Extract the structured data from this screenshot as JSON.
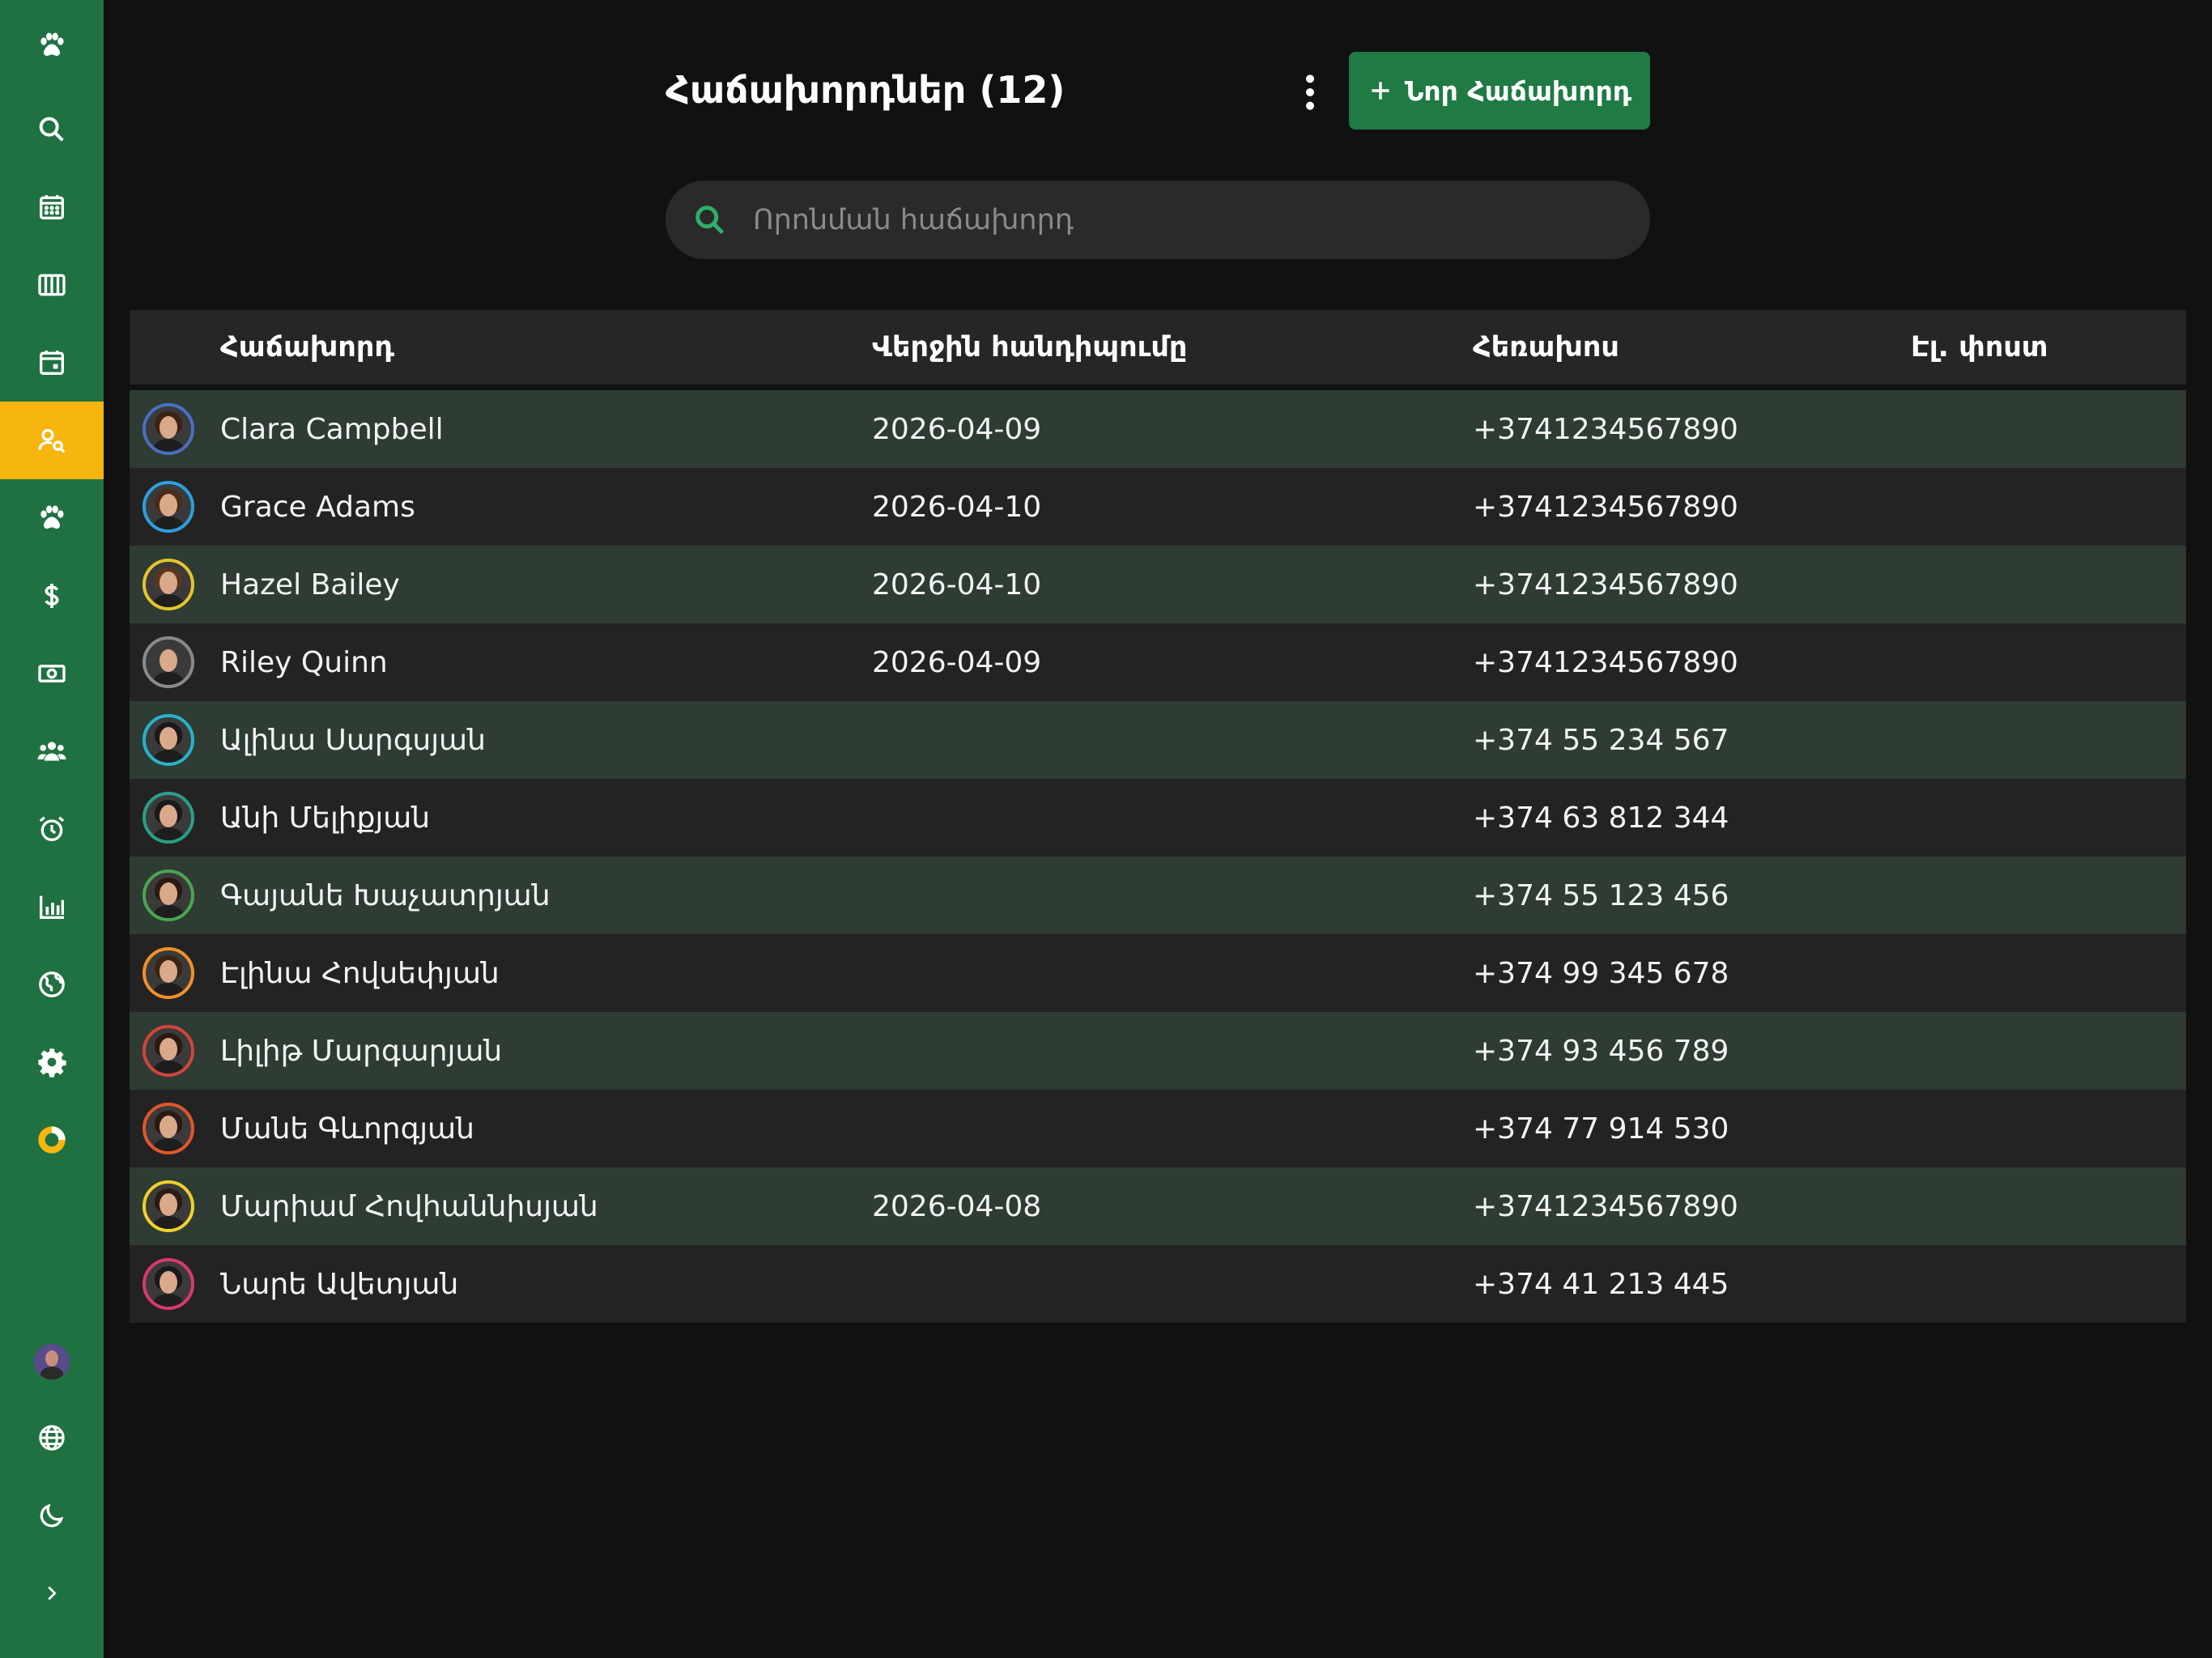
{
  "sidebar": {
    "items": [
      {
        "icon": "paw-icon",
        "active": false
      },
      {
        "icon": "search-icon",
        "active": false
      },
      {
        "icon": "calendar-icon",
        "active": false
      },
      {
        "icon": "columns-icon",
        "active": false
      },
      {
        "icon": "calendar-day-icon",
        "active": false
      },
      {
        "icon": "client-search-icon",
        "active": true
      },
      {
        "icon": "paw-icon",
        "active": false
      },
      {
        "icon": "dollar-icon",
        "active": false
      },
      {
        "icon": "cash-icon",
        "active": false
      },
      {
        "icon": "group-icon",
        "active": false
      },
      {
        "icon": "alarm-icon",
        "active": false
      },
      {
        "icon": "bar-chart-icon",
        "active": false
      },
      {
        "icon": "globe-icon",
        "active": false
      },
      {
        "icon": "gear-icon",
        "active": false
      },
      {
        "icon": "donut-icon",
        "active": false
      }
    ],
    "bottom": [
      {
        "icon": "user-avatar"
      },
      {
        "icon": "language-globe-icon"
      },
      {
        "icon": "moon-icon"
      },
      {
        "icon": "chevron-right-icon"
      }
    ],
    "colors": {
      "background": "#1f7141",
      "active": "#f6b50f"
    }
  },
  "header": {
    "title": "Հաճախորդներ (12)",
    "new_button_label": "Նոր Հաճախորդ",
    "more_icon": "more-vertical-icon"
  },
  "search": {
    "placeholder": "Որոնման հաճախորդ",
    "value": ""
  },
  "table": {
    "columns": [
      "Հաճախորդ",
      "Վերջին հանդիպումը",
      "Հեռախոս",
      "Էլ. փոստ"
    ],
    "rows": [
      {
        "name": "Clara Campbell",
        "last_visit": "2026-04-09",
        "phone": "+3741234567890",
        "email": "",
        "avatar_ring": "#4a6fc2",
        "hair": "#3b2417"
      },
      {
        "name": "Grace Adams",
        "last_visit": "2026-04-10",
        "phone": "+3741234567890",
        "email": "",
        "avatar_ring": "#2e9fdc",
        "hair": "#4a2c1a"
      },
      {
        "name": "Hazel Bailey",
        "last_visit": "2026-04-10",
        "phone": "+3741234567890",
        "email": "",
        "avatar_ring": "#e6c42a",
        "hair": "#5a3520"
      },
      {
        "name": "Riley Quinn",
        "last_visit": "2026-04-09",
        "phone": "+3741234567890",
        "email": "",
        "avatar_ring": "#8a8a8a",
        "hair": "#3a3a3a"
      },
      {
        "name": "Ալինա Սարգսյան",
        "last_visit": "",
        "phone": "+374 55 234 567",
        "email": "",
        "avatar_ring": "#25b3c9",
        "hair": "#1a1a1a"
      },
      {
        "name": "Անի Մելիքյան",
        "last_visit": "",
        "phone": "+374 63 812 344",
        "email": "",
        "avatar_ring": "#2a9e8a",
        "hair": "#1a1a1a"
      },
      {
        "name": "Գայանե Խաչատրյան",
        "last_visit": "",
        "phone": "+374 55 123 456",
        "email": "",
        "avatar_ring": "#4aa552",
        "hair": "#2a1a12"
      },
      {
        "name": "Էլինա Հովսեփյան",
        "last_visit": "",
        "phone": "+374 99 345 678",
        "email": "",
        "avatar_ring": "#f0902a",
        "hair": "#3a2416"
      },
      {
        "name": "Լիլիթ Մարգարյան",
        "last_visit": "",
        "phone": "+374 93 456 789",
        "email": "",
        "avatar_ring": "#d0453a",
        "hair": "#2a1a12"
      },
      {
        "name": "Մանե Գևորգյան",
        "last_visit": "",
        "phone": "+374 77 914 530",
        "email": "",
        "avatar_ring": "#e0562a",
        "hair": "#2a1a12"
      },
      {
        "name": "Մարիամ Հովհաննիսյան",
        "last_visit": "2026-04-08",
        "phone": "+3741234567890",
        "email": "",
        "avatar_ring": "#f0d02a",
        "hair": "#2a1a12"
      },
      {
        "name": "Նարե Ավետյան",
        "last_visit": "",
        "phone": "+374 41 213 445",
        "email": "",
        "avatar_ring": "#d83a6a",
        "hair": "#1a1a1a"
      }
    ]
  },
  "colors": {
    "page_background": "#111111",
    "accent_green": "#1f7a44",
    "row_odd": "#2e3c33",
    "row_even": "#232323"
  }
}
